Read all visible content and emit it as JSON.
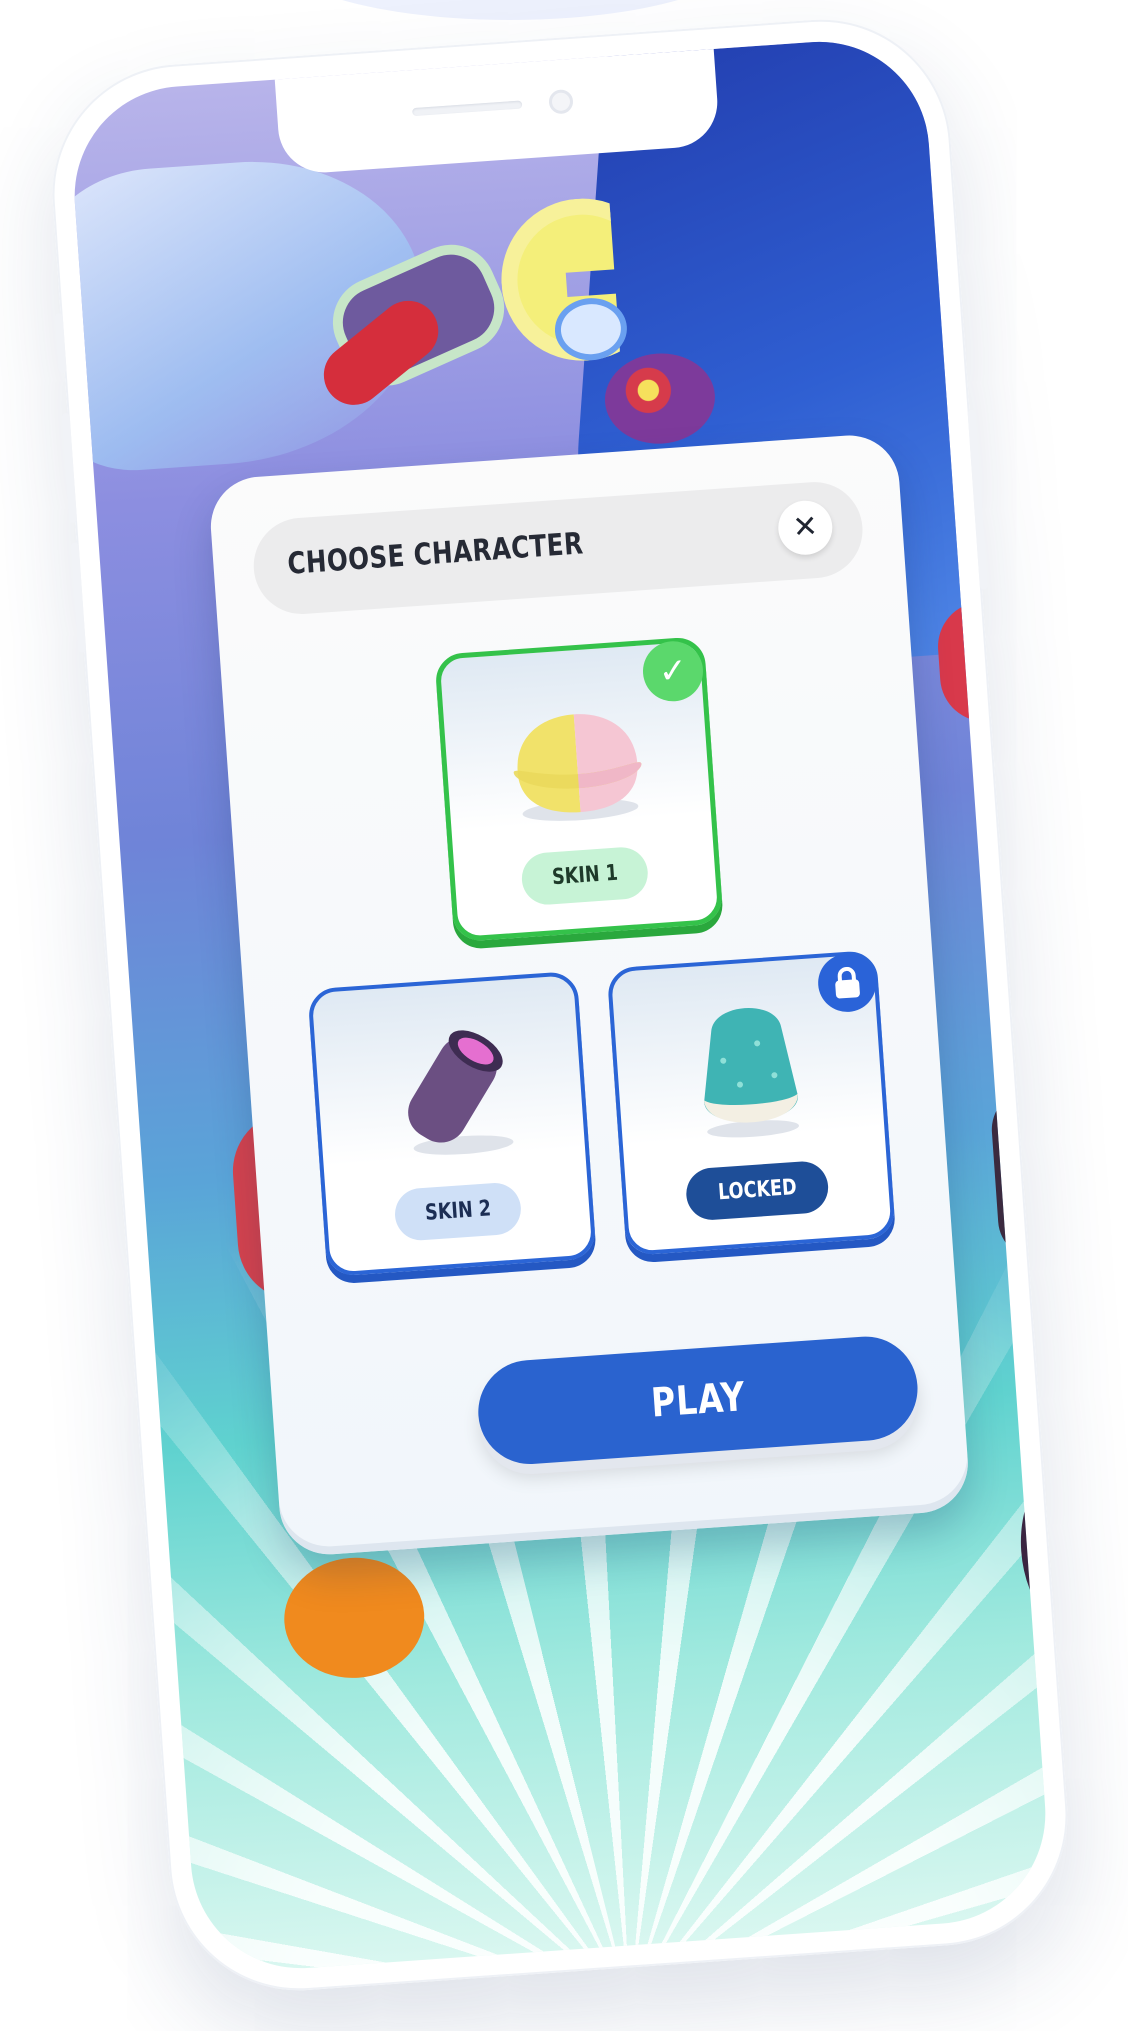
{
  "screen": {
    "title": "CHOOSE CHARACTER",
    "close_symbol": "✕",
    "play_label": "PLAY"
  },
  "skins": [
    {
      "label": "SKIN 1",
      "state": "selected",
      "icon": "check-icon",
      "accent": "#34c24a"
    },
    {
      "label": "SKIN 2",
      "state": "available",
      "accent": "#2b65d6"
    },
    {
      "label": "LOCKED",
      "state": "locked",
      "icon": "lock-icon",
      "accent": "#1e4e98"
    }
  ],
  "colors": {
    "primary": "#2a63cf",
    "selected": "#34c24a",
    "locked_pill": "#1e4e98"
  }
}
